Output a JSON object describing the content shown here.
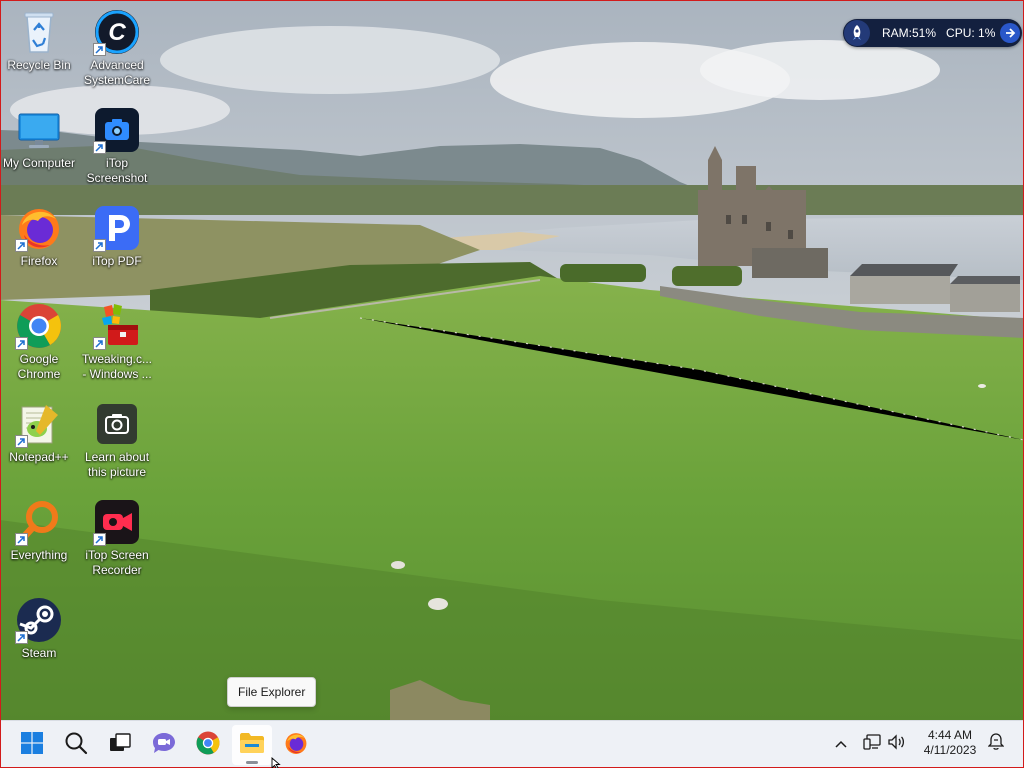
{
  "desktop": {
    "icons": [
      {
        "label": "Recycle Bin",
        "icon": "recycle-bin-icon",
        "shortcut": false
      },
      {
        "label": "Advanced\nSystemCare",
        "icon": "advanced-systemcare-icon",
        "shortcut": true
      },
      {
        "label": "My Computer",
        "icon": "monitor-icon",
        "shortcut": false
      },
      {
        "label": "iTop\nScreenshot",
        "icon": "itop-screenshot-icon",
        "shortcut": true
      },
      {
        "label": "Firefox",
        "icon": "firefox-icon",
        "shortcut": true
      },
      {
        "label": "iTop PDF",
        "icon": "itop-pdf-icon",
        "shortcut": true
      },
      {
        "label": "Google\nChrome",
        "icon": "chrome-icon",
        "shortcut": true
      },
      {
        "label": "Tweaking.c...\n- Windows ...",
        "icon": "tweaking-toolbox-icon",
        "shortcut": true
      },
      {
        "label": "Notepad++",
        "icon": "notepad-plus-plus-icon",
        "shortcut": true
      },
      {
        "label": "Learn about\nthis picture",
        "icon": "camera-icon",
        "shortcut": false
      },
      {
        "label": "Everything",
        "icon": "everything-search-icon",
        "shortcut": true
      },
      {
        "label": "iTop Screen\nRecorder",
        "icon": "itop-screen-recorder-icon",
        "shortcut": true
      },
      {
        "label": "Steam",
        "icon": "steam-icon",
        "shortcut": true
      }
    ]
  },
  "widget": {
    "ram_label": "RAM:51%",
    "cpu_label": "CPU: 1%"
  },
  "tooltip": {
    "text": "File Explorer"
  },
  "taskbar": {
    "pinned": [
      {
        "name": "start-button",
        "icon": "windows-logo-icon"
      },
      {
        "name": "search-button",
        "icon": "search-icon"
      },
      {
        "name": "task-view-button",
        "icon": "task-view-icon"
      },
      {
        "name": "teams-chat-button",
        "icon": "chat-camera-icon"
      },
      {
        "name": "chrome-taskbar-button",
        "icon": "chrome-icon"
      },
      {
        "name": "file-explorer-button",
        "icon": "folder-icon"
      },
      {
        "name": "firefox-taskbar-button",
        "icon": "firefox-icon"
      }
    ],
    "clock": {
      "time": "4:44 AM",
      "date": "4/11/2023"
    }
  },
  "colors": {
    "taskbar_bg": "#eef1f6",
    "widget_bg": "#13203f",
    "frame_border": "#d21b1b"
  }
}
